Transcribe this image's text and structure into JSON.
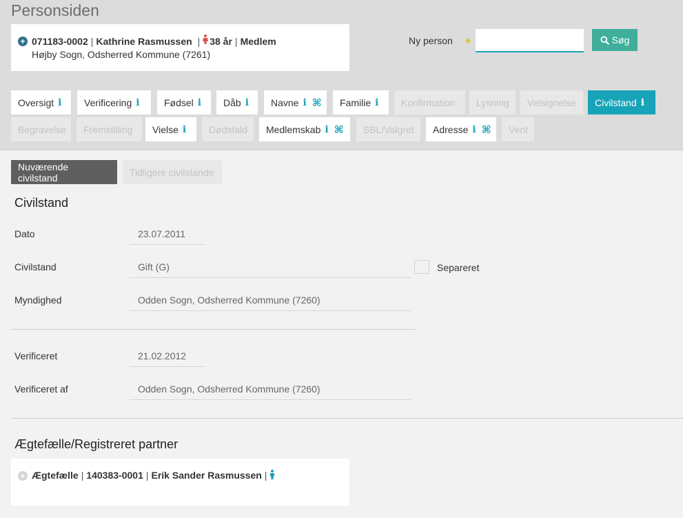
{
  "page": {
    "title": "Personsiden"
  },
  "person": {
    "cpr": "071183-0002",
    "name": "Kathrine Rasmussen",
    "age": "38 år",
    "status": "Medlem",
    "address": "Højby Sogn, Odsherred Kommune (7261)"
  },
  "search": {
    "new_person_label": "Ny person",
    "input_value": "",
    "button_label": "Søg"
  },
  "tabs_row1": [
    {
      "label": "Oversigt",
      "info": "i"
    },
    {
      "label": "Verificering",
      "info": "i"
    },
    {
      "label": "Fødsel",
      "info": "i"
    },
    {
      "label": "Dåb",
      "info": "i"
    },
    {
      "label": "Navne",
      "info": "i",
      "cmd": "⌘"
    },
    {
      "label": "Familie",
      "info": "i"
    },
    {
      "label": "Konfirmation"
    },
    {
      "label": "Lysning"
    },
    {
      "label": "Velsignelse"
    },
    {
      "label": "Civilstand",
      "info": "i"
    }
  ],
  "tabs_row2": [
    {
      "label": "Begravelse"
    },
    {
      "label": "Fremstilling"
    },
    {
      "label": "Vielse",
      "info": "i"
    },
    {
      "label": "Dødsfald"
    },
    {
      "label": "Medlemskab",
      "info": "i",
      "cmd": "⌘"
    },
    {
      "label": "SBL/Valgret"
    },
    {
      "label": "Adresse",
      "info": "i",
      "cmd": "⌘"
    },
    {
      "label": "Vent"
    }
  ],
  "subtabs": {
    "current": "Nuværende civilstand",
    "previous": "Tidligere civilstande"
  },
  "civilstand": {
    "title": "Civilstand",
    "dato_label": "Dato",
    "dato_value": "23.07.2011",
    "civilstand_label": "Civilstand",
    "civilstand_value": "Gift (G)",
    "separeret_label": "Separeret",
    "myndighed_label": "Myndighed",
    "myndighed_value": "Odden Sogn, Odsherred Kommune (7260)",
    "verificeret_label": "Verificeret",
    "verificeret_value": "21.02.2012",
    "verificeret_af_label": "Verificeret af",
    "verificeret_af_value": "Odden Sogn, Odsherred Kommune (7260)"
  },
  "partner": {
    "section_title": "Ægtefælle/Registreret partner",
    "role": "Ægtefælle",
    "cpr": "140383-0001",
    "name": "Erik Sander Rasmussen"
  },
  "colors": {
    "accent": "#17a3b8",
    "search_button": "#3fae9a",
    "header_bg": "#dcdcdc"
  }
}
